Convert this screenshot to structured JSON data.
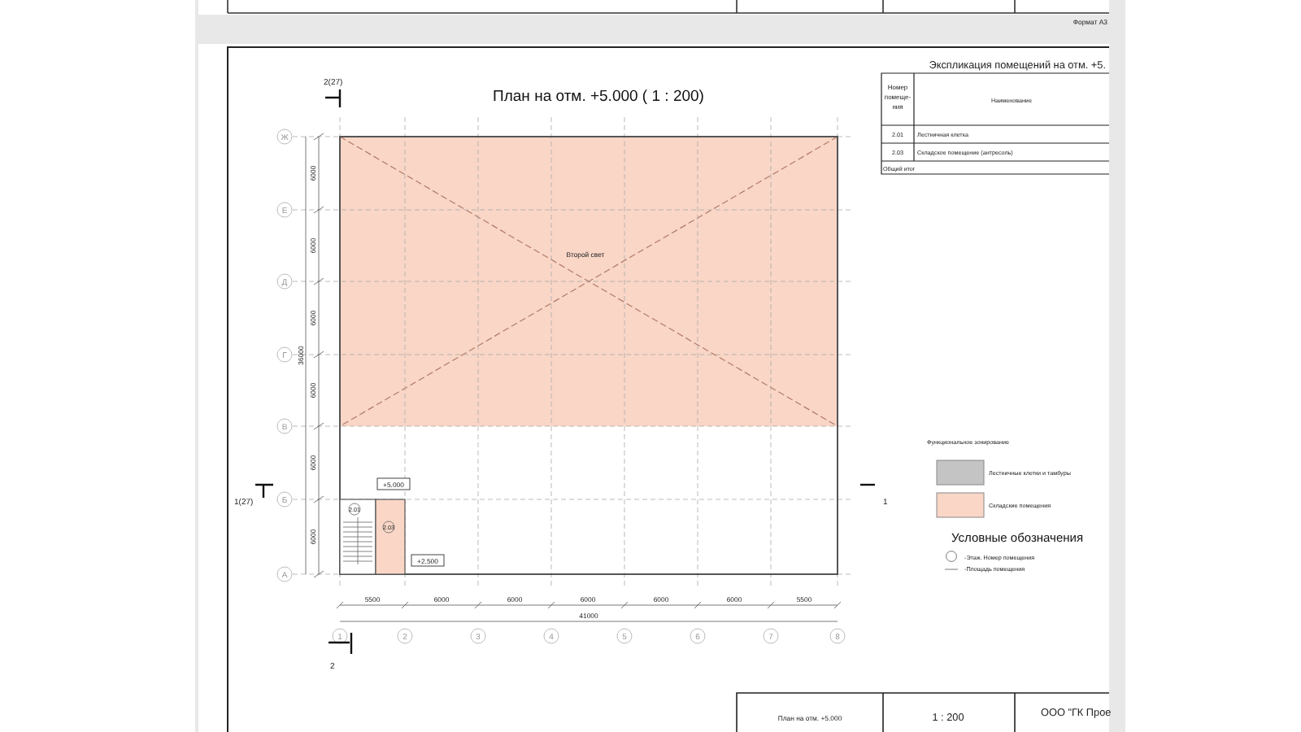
{
  "previous_page": {
    "format_label": "Формат А3"
  },
  "plan": {
    "title": "План на отм. +5.000 ( 1 : 200)",
    "section_marks": [
      "2(27)",
      "1(27)",
      "1",
      "2"
    ],
    "row_axes": [
      "Ж",
      "Е",
      "Д",
      "Г",
      "В",
      "Б",
      "А"
    ],
    "column_axes": [
      "1",
      "2",
      "3",
      "4",
      "5",
      "6",
      "7",
      "8"
    ],
    "row_dims": [
      "6000",
      "6000",
      "6000",
      "6000",
      "6000",
      "6000"
    ],
    "total_row_dim": "36000",
    "column_dims": [
      "5500",
      "6000",
      "6000",
      "6000",
      "6000",
      "6000",
      "5500"
    ],
    "total_column_dim": "41000",
    "zone_label": "Второй свет",
    "levels": [
      "+5.000",
      "+2.500"
    ],
    "room_tags": [
      "2.01",
      "2.03"
    ]
  },
  "schedule": {
    "title": "Экспликация помещений на отм. +5.",
    "columns": [
      "Номер помеще-ния",
      "Наименование"
    ],
    "rows": [
      {
        "number": "2.01",
        "name": "Лестничная клетка"
      },
      {
        "number": "2.03",
        "name": "Складское помещение (антресоль)"
      }
    ],
    "footer": "Общий итог"
  },
  "legend": {
    "title": "Функциональное зонирование",
    "items": [
      {
        "label": "Лестничные клетки и тамбуры",
        "color": "#c4c4c4"
      },
      {
        "label": "Складские помещения",
        "color": "#f9d6c6"
      }
    ]
  },
  "symbols": {
    "title": "Условные обозначения",
    "items": [
      "-Этаж. Номер помещения",
      "-Площадь помещения"
    ]
  },
  "title_block": {
    "cells": [
      "План на отм. +5.000",
      "1 : 200",
      "ООО \"ГК Прое"
    ]
  }
}
